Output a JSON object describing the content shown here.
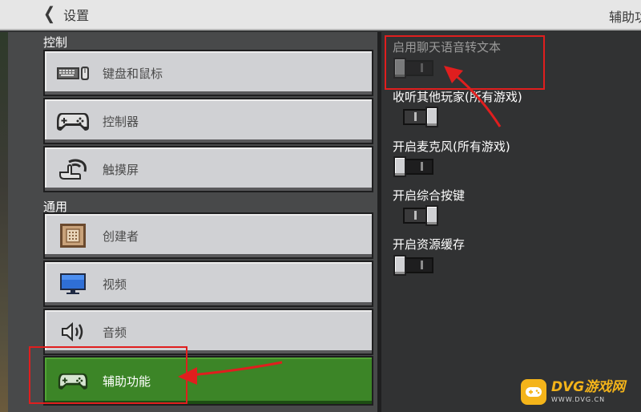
{
  "header": {
    "back_label": "设置",
    "page_title": "辅助功"
  },
  "sections": {
    "controls": "控制",
    "general": "通用"
  },
  "menu": [
    {
      "label": "键盘和鼠标",
      "icon": "keyboard-mouse-icon"
    },
    {
      "label": "控制器",
      "icon": "gamepad-icon"
    },
    {
      "label": "触摸屏",
      "icon": "touch-hand-icon"
    },
    {
      "label": "创建者",
      "icon": "creator-icon"
    },
    {
      "label": "视频",
      "icon": "monitor-icon"
    },
    {
      "label": "音频",
      "icon": "speaker-icon"
    },
    {
      "label": "辅助功能",
      "icon": "gamepad-icon",
      "selected": true
    }
  ],
  "options": [
    {
      "label": "启用聊天语音转文本",
      "state": "off",
      "enabled": false
    },
    {
      "label": "收听其他玩家(所有游戏)",
      "state": "on",
      "enabled": true
    },
    {
      "label": "开启麦克风(所有游戏)",
      "state": "off",
      "enabled": true
    },
    {
      "label": "开启综合按键",
      "state": "on",
      "enabled": true
    },
    {
      "label": "开启资源缓存",
      "state": "off",
      "enabled": true
    }
  ],
  "watermark": {
    "brand": "DVG游戏网",
    "url": "WWW.DVG.CN"
  },
  "colors": {
    "accent_green": "#3c8527",
    "annotation_red": "#e01e1e",
    "watermark_gold": "#f4b41a"
  }
}
